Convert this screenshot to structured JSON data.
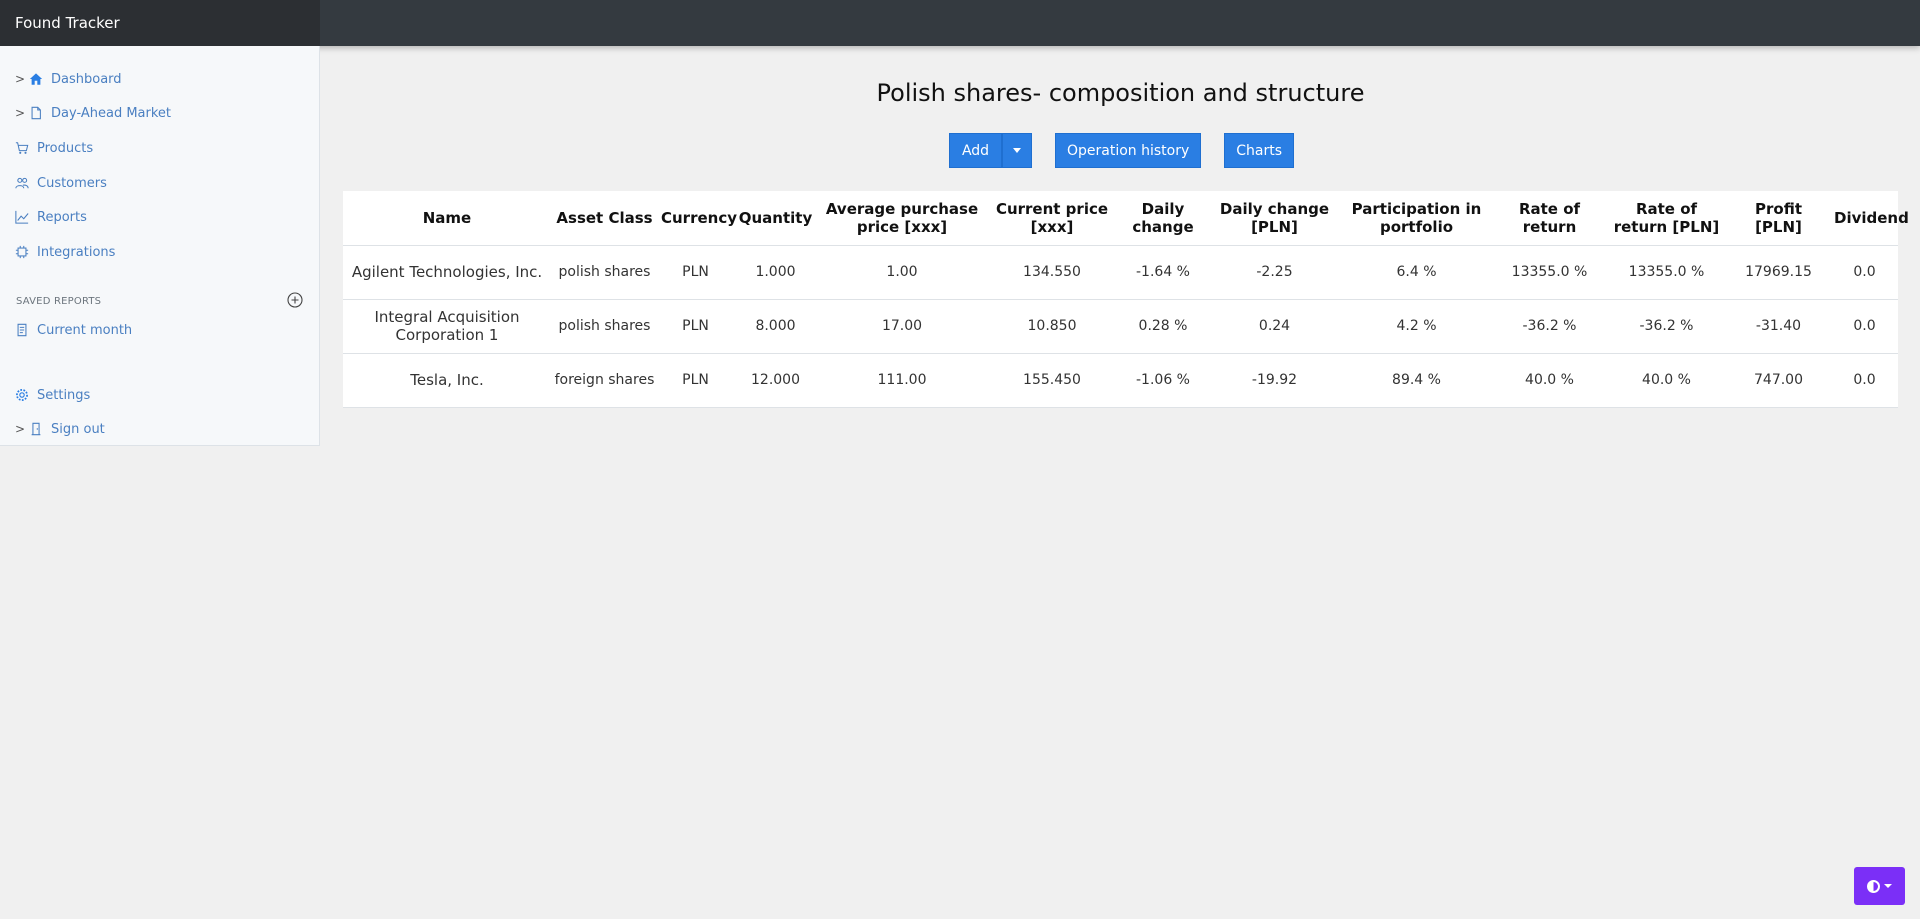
{
  "app": {
    "title": "Found Tracker"
  },
  "sidebar": {
    "items": [
      {
        "label": "Dashboard",
        "icon": "house-icon",
        "chevron": ">"
      },
      {
        "label": "Day-Ahead Market",
        "icon": "file-icon",
        "chevron": ">"
      },
      {
        "label": "Products",
        "icon": "cart-icon"
      },
      {
        "label": "Customers",
        "icon": "people-icon"
      },
      {
        "label": "Reports",
        "icon": "chart-line-icon"
      },
      {
        "label": "Integrations",
        "icon": "cpu-icon"
      }
    ],
    "saved_reports": {
      "heading": "SAVED REPORTS",
      "items": [
        {
          "label": "Current month",
          "icon": "file-text-icon"
        }
      ]
    },
    "settings": {
      "label": "Settings",
      "icon": "gear-icon"
    },
    "signout": {
      "label": "Sign out",
      "icon": "door-icon",
      "chevron": ">"
    }
  },
  "main": {
    "title": "Polish shares- composition and structure",
    "buttons": {
      "add": "Add",
      "operation_history": "Operation history",
      "charts": "Charts"
    },
    "table": {
      "headers": [
        "Name",
        "Asset Class",
        "Currency",
        "Quantity",
        "Average purchase price [xxx]",
        "Current price [xxx]",
        "Daily change",
        "Daily change [PLN]",
        "Participation in portfolio",
        "Rate of return",
        "Rate of return [PLN]",
        "Profit [PLN]",
        "Dividend"
      ],
      "rows": [
        [
          "Agilent Technologies, Inc.",
          "polish shares",
          "PLN",
          "1.000",
          "1.00",
          "134.550",
          "-1.64 %",
          "-2.25",
          "6.4 %",
          "13355.0 %",
          "13355.0 %",
          "17969.15",
          "0.0"
        ],
        [
          "Integral Acquisition Corporation 1",
          "polish shares",
          "PLN",
          "8.000",
          "17.00",
          "10.850",
          "0.28 %",
          "0.24",
          "4.2 %",
          "-36.2 %",
          "-36.2 %",
          "-31.40",
          "0.0"
        ],
        [
          "Tesla, Inc.",
          "foreign shares",
          "PLN",
          "12.000",
          "111.00",
          "155.450",
          "-1.06 %",
          "-19.92",
          "89.4 %",
          "40.0 %",
          "40.0 %",
          "747.00",
          "0.0"
        ]
      ]
    }
  },
  "colors": {
    "primary": "#2a7ee3",
    "topbar": "#343a40",
    "theme_toggle": "#7b2ff7",
    "link": "#4a7fc1"
  }
}
